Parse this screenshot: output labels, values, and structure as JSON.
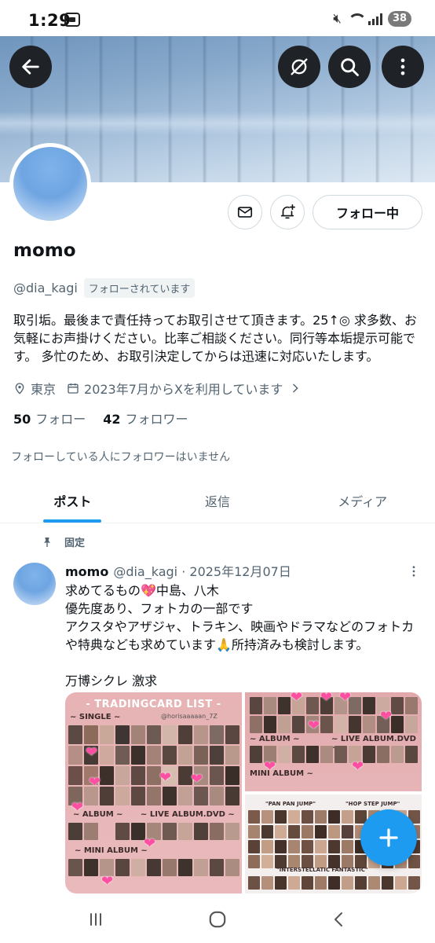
{
  "status_bar": {
    "time": "1:29",
    "battery": "38"
  },
  "profile": {
    "display_name": "momo",
    "handle": "@dia_kagi",
    "follows_you_badge": "フォローされています",
    "bio": "取引垢。最後まで責任持ってお取引させて頂きます。25↑◎ 求多数、お気軽にお声掛けください。比率ご相談ください。同行等本垢提示可能です。 多忙のため、お取引決定してからは迅速に対応いたします。",
    "location": "東京",
    "joined": "2023年7月からXを利用しています",
    "following_count": "50",
    "following_label": "フォロー",
    "followers_count": "42",
    "followers_label": "フォロワー",
    "mutual_note": "フォローしている人にフォロワーはいません",
    "follow_button_label": "フォロー中"
  },
  "tabs": [
    {
      "label": "ポスト",
      "active": true
    },
    {
      "label": "返信",
      "active": false
    },
    {
      "label": "メディア",
      "active": false
    }
  ],
  "pinned_post": {
    "pinned_label": "固定",
    "author_name": "momo",
    "author_meta": "@dia_kagi · 2025年12月07日",
    "text": "求めてるもの💖中島、八木\n優先度あり、フォトカの一部です\nアクスタやアザジャ、トラキン、映画やドラマなどのフォトカや特典なども求めています🙏所持済みも検討します。\n\n万博シクレ 激求",
    "media": {
      "left_title": "- TRADINGCARD LIST -",
      "left_watermark": "@horisaaaaan_7Z",
      "left_sections": [
        "~ SINGLE ~",
        "~ ALBUM ~",
        "~ LIVE ALBUM.DVD ~",
        "~ MINI ALBUM ~"
      ],
      "right_top_sections": [
        "~ ALBUM ~",
        "~ LIVE ALBUM.DVD ~",
        "MINI ALBUM ~"
      ],
      "right_bottom_labels": [
        "\"PAN PAN JUMP\"",
        "\"HOP STEP JUMP\"",
        "\"INTERSTELLATIC FANTASTIC\""
      ]
    }
  },
  "colors": {
    "accent": "#1d9bf0",
    "text_primary": "#0f1419",
    "text_secondary": "#536471",
    "heart": "#ff4fa3"
  },
  "icons": {
    "back": "arrow-left-icon",
    "hide": "eye-slash-icon",
    "search": "search-icon",
    "more": "more-vertical-icon",
    "message": "envelope-icon",
    "notify": "bell-plus-icon",
    "location": "map-pin-icon",
    "calendar": "calendar-icon",
    "pin": "pin-icon",
    "compose": "plus-icon"
  }
}
